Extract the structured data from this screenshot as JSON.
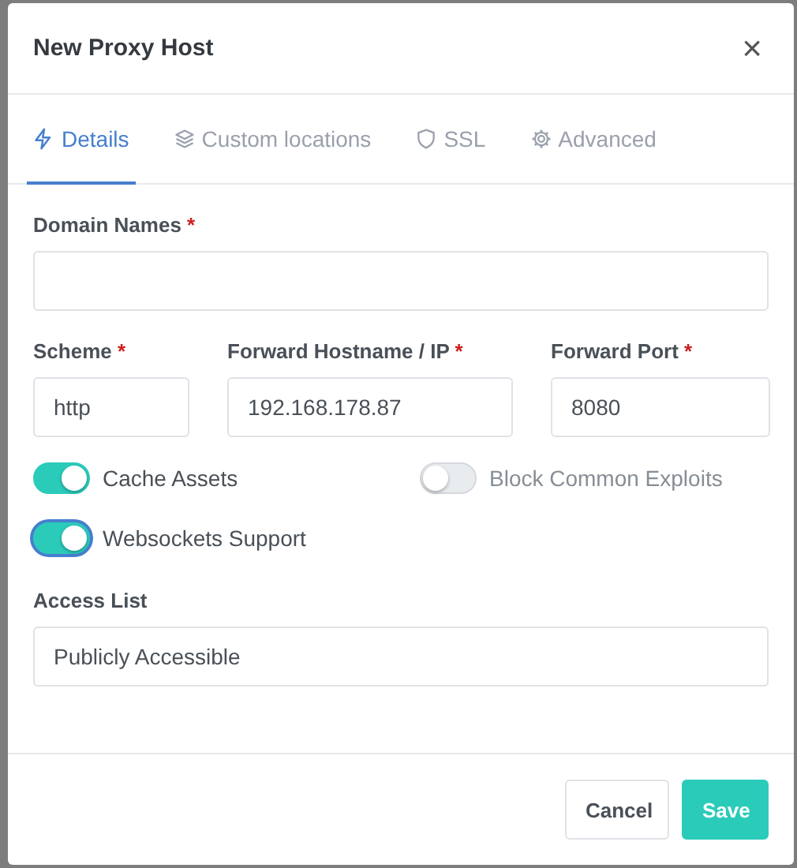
{
  "dialog": {
    "title": "New Proxy Host",
    "close": "×"
  },
  "tabs": [
    {
      "label": "Details",
      "kind": "bolt",
      "selected": true
    },
    {
      "label": "Custom locations",
      "kind": "layers",
      "selected": false
    },
    {
      "label": "SSL",
      "kind": "shield",
      "selected": false
    },
    {
      "label": "Advanced",
      "kind": "gear",
      "selected": false
    }
  ],
  "domain": {
    "label": "Domain Names",
    "mark": "*"
  },
  "forward_fields": [
    {
      "label": "Scheme",
      "mark": "*",
      "value": "http"
    },
    {
      "label": "Forward Hostname / IP",
      "mark": "*",
      "value": "192.168.178.87"
    },
    {
      "label": "Forward Port",
      "mark": "*",
      "value": "8080"
    }
  ],
  "toggles": [
    {
      "label": "Cache Assets",
      "on": true,
      "focused": false
    },
    {
      "label": "Block Common Exploits",
      "on": false,
      "focused": false
    },
    {
      "label": "Websockets Support",
      "on": true,
      "focused": true
    }
  ],
  "access_list": {
    "label": "Access List",
    "value": "Publicly Accessible"
  },
  "buttons": [
    {
      "label": "Cancel",
      "kind": "secondary"
    },
    {
      "label": "Save",
      "kind": "primary"
    }
  ]
}
